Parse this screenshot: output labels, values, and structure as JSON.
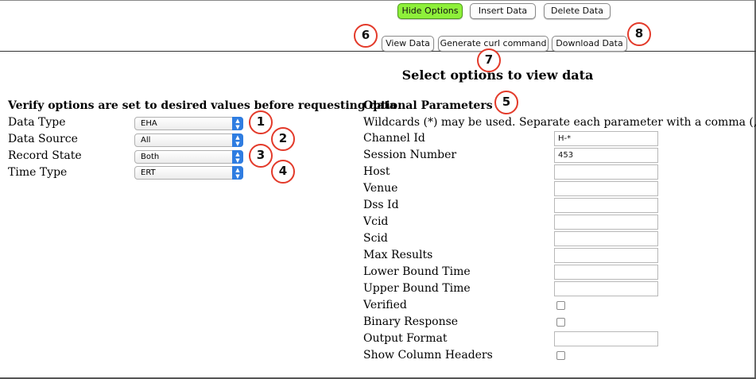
{
  "toolbar": {
    "hide_options": "Hide Options",
    "insert_data": "Insert Data",
    "delete_data": "Delete Data",
    "view_data": "View Data",
    "generate_curl": "Generate curl command",
    "download_data": "Download Data"
  },
  "page_title": "Select options to view data",
  "left": {
    "heading": "Verify options are set to desired values before requesting data",
    "fields": [
      {
        "label": "Data Type",
        "value": "EHA"
      },
      {
        "label": "Data Source",
        "value": "All"
      },
      {
        "label": "Record State",
        "value": "Both"
      },
      {
        "label": "Time Type",
        "value": "ERT"
      }
    ]
  },
  "right": {
    "heading": "Optional Parameters",
    "hint": "Wildcards (*) may be used. Separate each parameter with a comma (,)",
    "params": [
      {
        "label": "Channel Id",
        "value": "H-*"
      },
      {
        "label": "Session Number",
        "value": "453"
      },
      {
        "label": "Host",
        "value": ""
      },
      {
        "label": "Venue",
        "value": ""
      },
      {
        "label": "Dss Id",
        "value": ""
      },
      {
        "label": "Vcid",
        "value": ""
      },
      {
        "label": "Scid",
        "value": ""
      },
      {
        "label": "Max Results",
        "value": ""
      },
      {
        "label": "Lower Bound Time",
        "value": ""
      },
      {
        "label": "Upper Bound Time",
        "value": ""
      },
      {
        "label": "Verified",
        "checked": false
      },
      {
        "label": "Binary Response",
        "checked": false
      },
      {
        "label": "Output Format",
        "value": ""
      },
      {
        "label": "Show Column Headers",
        "checked": false
      }
    ]
  },
  "annotations": [
    "1",
    "2",
    "3",
    "4",
    "5",
    "6",
    "7",
    "8"
  ],
  "colors": {
    "accent_green": "#8ef03a",
    "annotation_red": "#e33a2a",
    "select_blue": "#2f7de1"
  }
}
